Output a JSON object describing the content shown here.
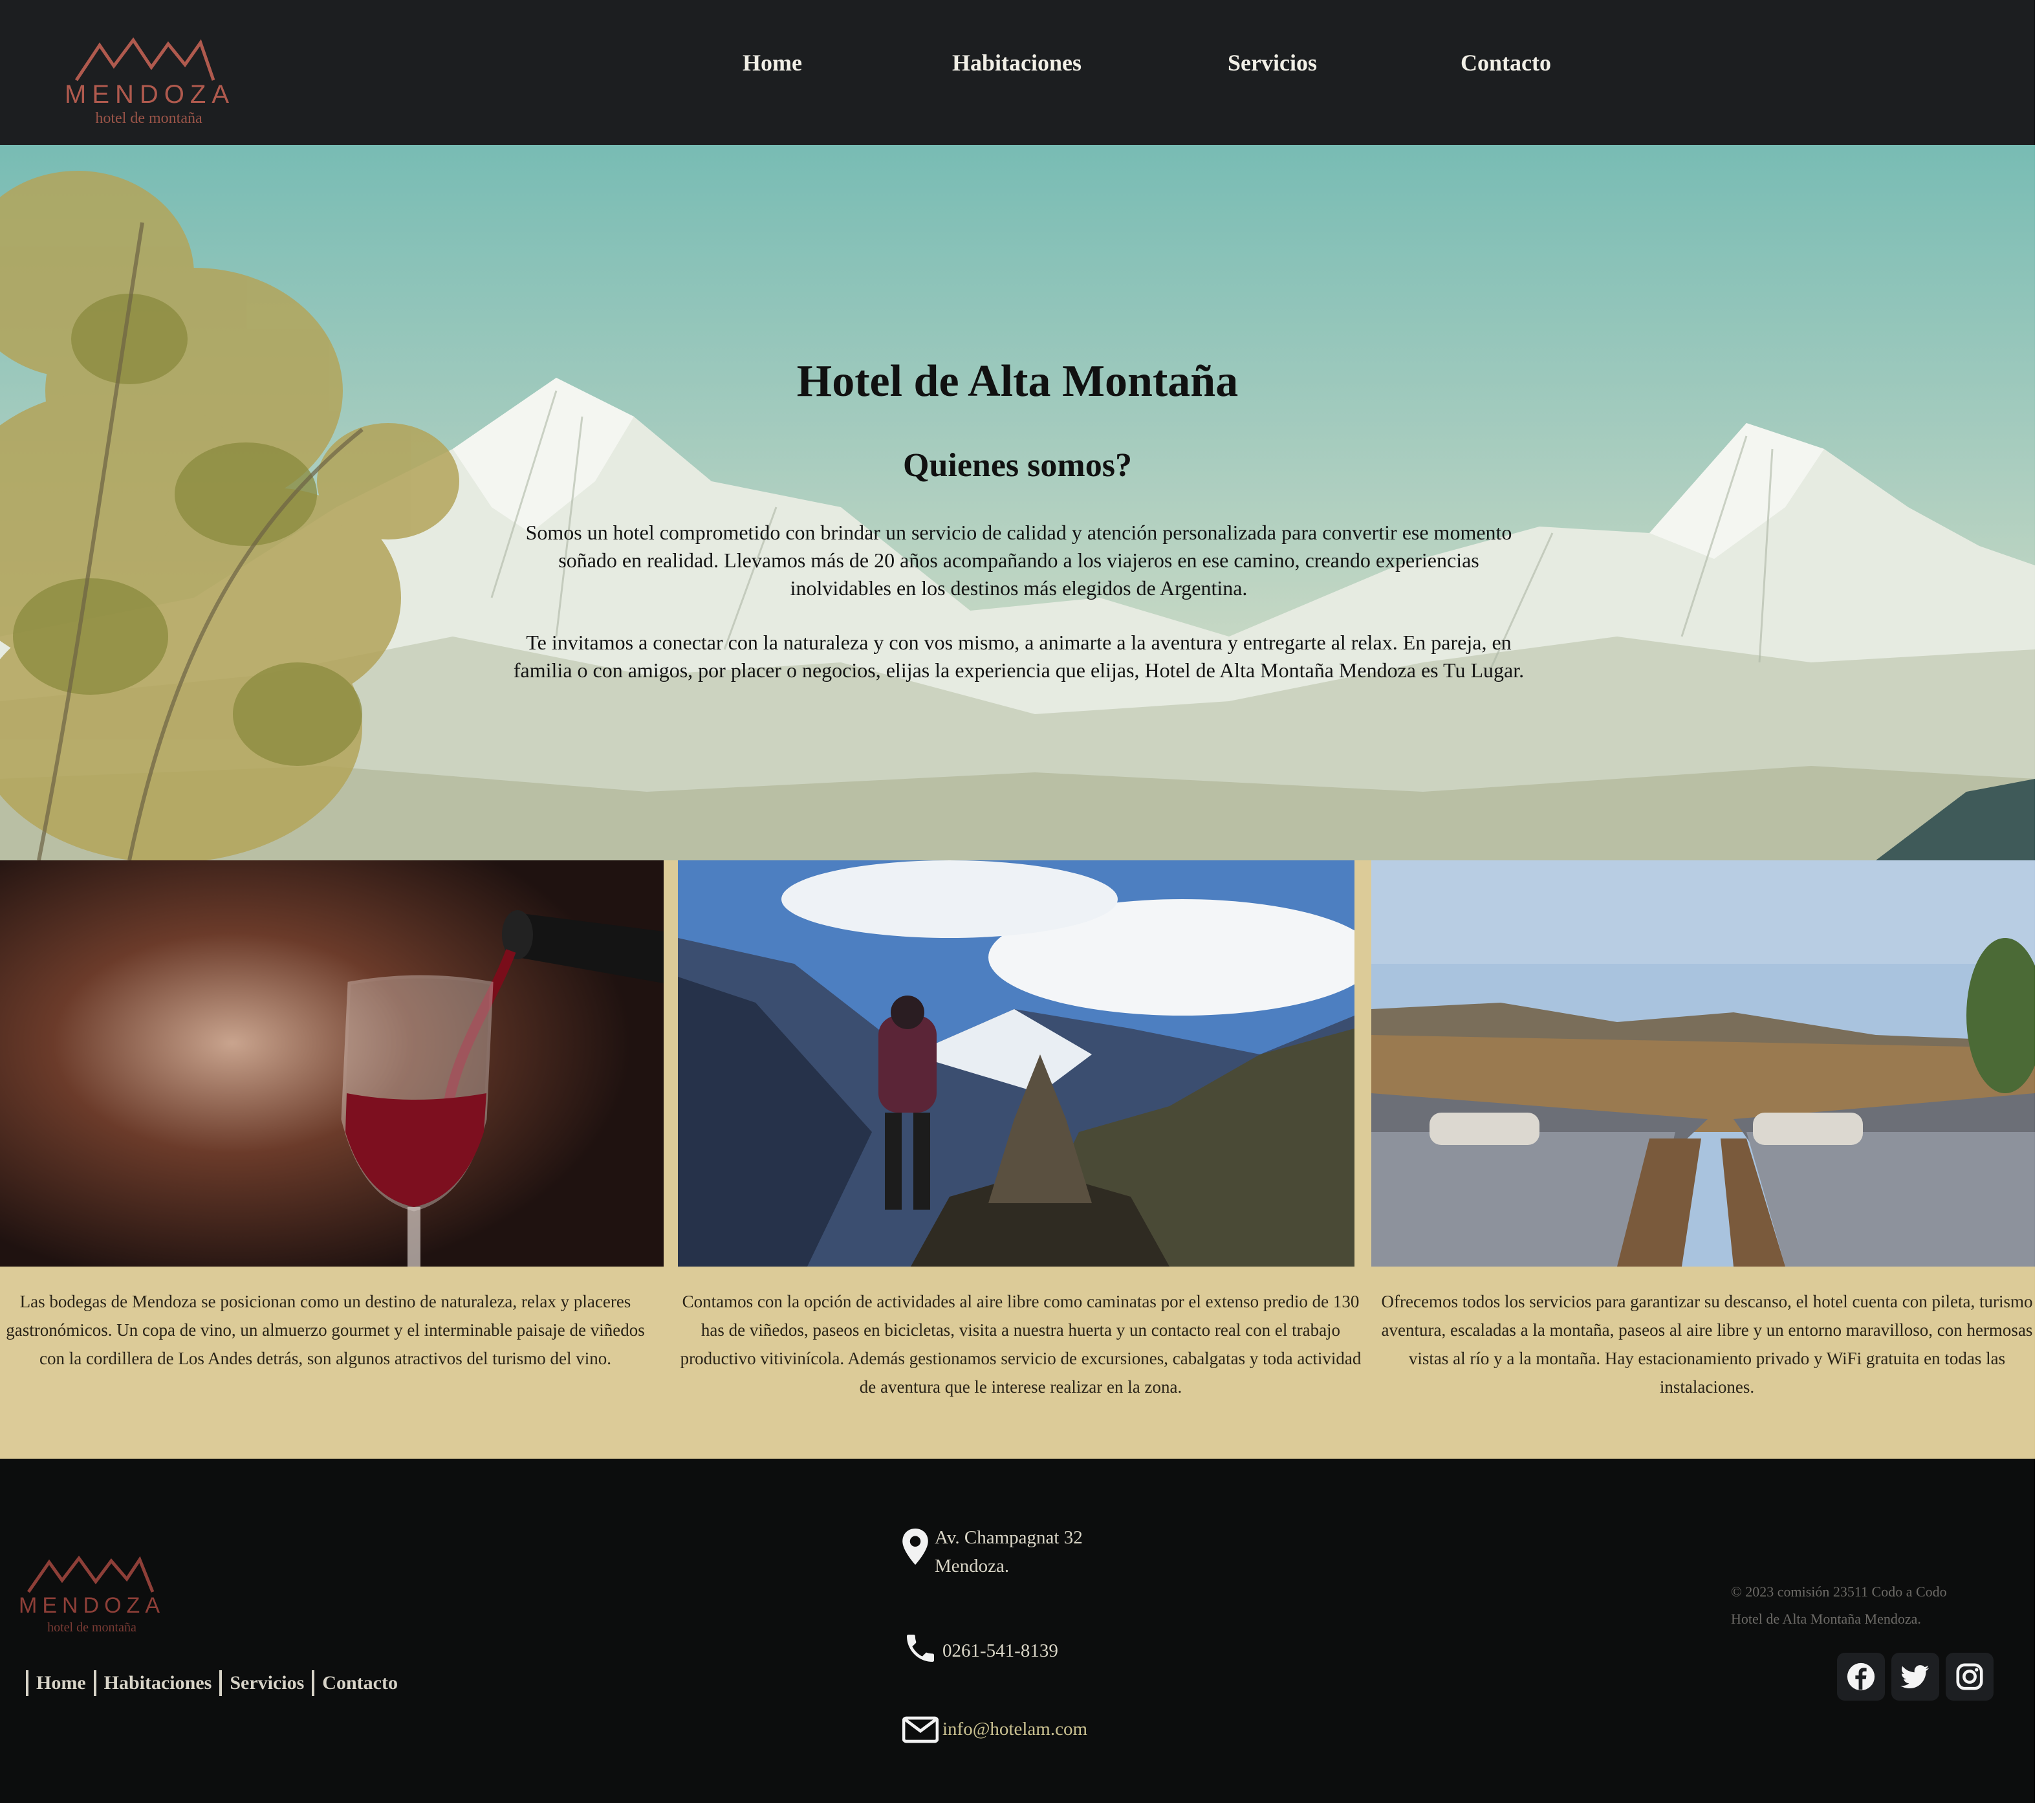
{
  "header": {
    "logo": {
      "brand": "MENDOZA",
      "tagline": "hotel de montaña"
    },
    "nav": [
      {
        "label": "Home"
      },
      {
        "label": "Habitaciones"
      },
      {
        "label": "Servicios"
      },
      {
        "label": "Contacto"
      }
    ]
  },
  "hero": {
    "title": "Hotel de Alta Montaña",
    "subtitle": "Quienes somos?",
    "paragraphs": [
      "Somos un hotel comprometido con brindar un servicio de calidad y atención personalizada para convertir ese momento soñado en realidad. Llevamos más de 20 años acompañando a los viajeros en ese camino, creando experiencias inolvidables en los destinos más elegidos de Argentina.",
      "Te invitamos a conectar con la naturaleza y con vos mismo, a animarte a la aventura y entregarte al relax. En pareja, en familia o con amigos, por placer o negocios, elijas la experiencia que elijas, Hotel de Alta Montaña Mendoza es Tu Lugar."
    ]
  },
  "cards": [
    {
      "image": "wine-glass-pour",
      "text": "Las bodegas de Mendoza se posicionan como un destino de naturaleza, relax y placeres gastronómicos. Un copa de vino, un almuerzo gourmet y el interminable paisaje de viñedos con la cordillera de Los Andes detrás, son algunos atractivos del turismo del vino."
    },
    {
      "image": "hiker-mountain-valley",
      "text": "Contamos con la opción de actividades al aire libre como caminatas por el extenso predio de 130 has de viñedos, paseos en bicicletas, visita a nuestra huerta y un contacto real con el trabajo productivo vitivinícola. Además gestionamos servicio de excursiones, cabalgatas y toda actividad de aventura que le interese realizar en la zona."
    },
    {
      "image": "pool-loungers-view",
      "text": "Ofrecemos todos los servicios para garantizar su descanso, el hotel cuenta con pileta, turismo aventura, escaladas a la montaña, paseos al aire libre y un entorno maravilloso, con hermosas vistas al río y a la montaña. Hay estacionamiento privado y WiFi gratuita en todas las instalaciones."
    }
  ],
  "footer": {
    "logo": {
      "brand": "MENDOZA",
      "tagline": "hotel de montaña"
    },
    "nav": [
      {
        "label": "Home"
      },
      {
        "label": "Habitaciones"
      },
      {
        "label": "Servicios"
      },
      {
        "label": "Contacto"
      }
    ],
    "address_line1": "Av. Champagnat 32",
    "address_line2": "Mendoza.",
    "phone": "0261-541-8139",
    "email": "info@hotelam.com",
    "copyright_line1": "© 2023 comisión 23511 Codo a Codo",
    "copyright_line2": "Hotel de Alta Montaña Mendoza.",
    "social": [
      {
        "icon": "facebook-icon"
      },
      {
        "icon": "twitter-icon"
      },
      {
        "icon": "instagram-icon"
      }
    ]
  },
  "colors": {
    "header_bg": "#1c1e20",
    "footer_bg": "#0c0d0d",
    "cards_bg": "#dccb98",
    "logo_accent": "#b05a4e",
    "sky": "#78bcb4"
  }
}
